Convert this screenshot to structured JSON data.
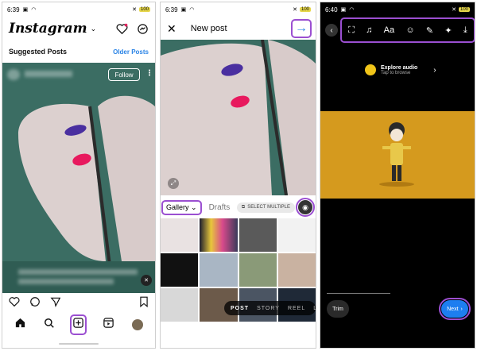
{
  "panel1": {
    "status": {
      "time": "6:39",
      "battery": "100"
    },
    "app_name": "Instagram",
    "suggested_posts": "Suggested Posts",
    "older_posts": "Older Posts",
    "follow": "Follow",
    "icons": [
      "heart-icon",
      "messenger-icon",
      "comment-icon",
      "share-icon",
      "bookmark-icon",
      "home-icon",
      "search-icon",
      "create-icon",
      "reels-icon"
    ]
  },
  "panel2": {
    "status": {
      "time": "6:39",
      "battery": "100"
    },
    "title": "New post",
    "gallery": "Gallery",
    "drafts": "Drafts",
    "select_multiple": "SELECT MULTIPLE",
    "modes": [
      "POST",
      "STORY",
      "REEL",
      "LI"
    ]
  },
  "panel3": {
    "status": {
      "time": "6:40",
      "battery": "100"
    },
    "tools": [
      "Aa"
    ],
    "explore_audio": "Explore audio",
    "tap_browse": "Tap to browse",
    "trim": "Trim",
    "next": "Next"
  },
  "colors": {
    "highlight": "#9b4fd1",
    "link_blue": "#2b84e6",
    "next_blue": "#1d7ef0",
    "photo_bg": "#33665c",
    "video_bg": "#d59a1e"
  }
}
